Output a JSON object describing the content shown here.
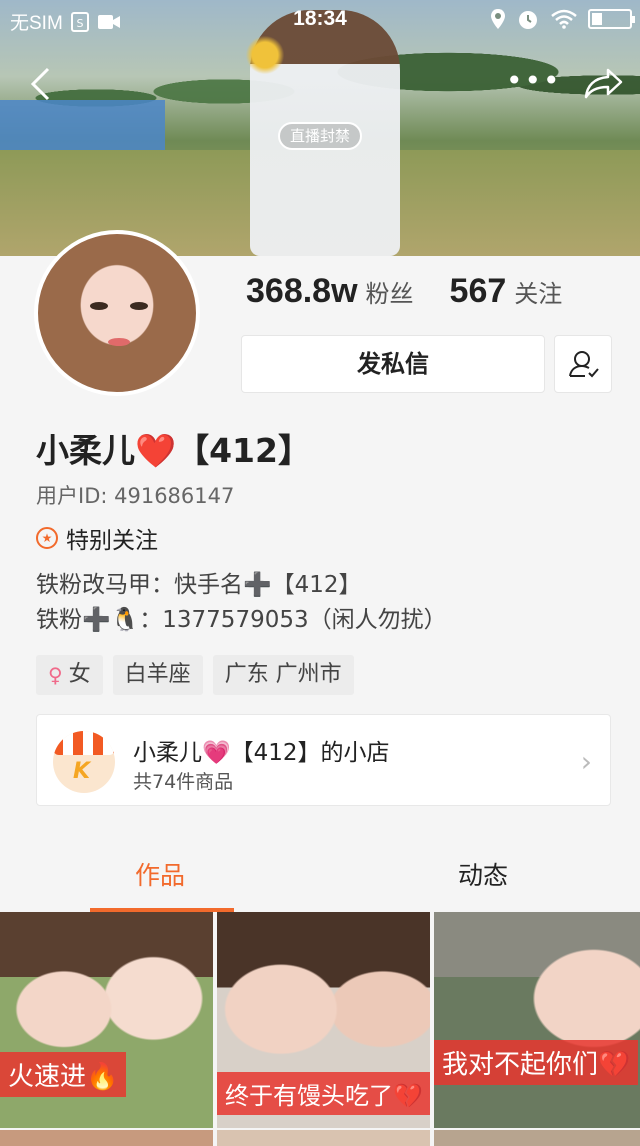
{
  "status_bar": {
    "carrier": "无SIM",
    "time": "18:34"
  },
  "cover": {
    "live_badge": "直播封禁"
  },
  "nav": {
    "back_icon": "chevron-left-icon",
    "more": "•••",
    "share_icon": "share-arrow-icon"
  },
  "profile": {
    "fans_count": "368.8w",
    "fans_label": "粉丝",
    "following_count": "567",
    "following_label": "关注",
    "message_button": "发私信",
    "name": "小柔儿❤️【412】",
    "user_id": "用户ID: 491686147",
    "special_follow": "特别关注",
    "bio_line1": "铁粉改马甲：快手名➕【412】",
    "bio_line2": "铁粉➕🐧：1377579053（闲人勿扰）"
  },
  "tags": [
    {
      "label": "女",
      "icon": "female-icon"
    },
    {
      "label": "白羊座"
    },
    {
      "label": "广东 广州市"
    }
  ],
  "shop": {
    "title": "小柔儿💗【412】的小店",
    "subtitle": "共74件商品",
    "logo_letter": "K"
  },
  "tabs": {
    "works": "作品",
    "dynamic": "动态"
  },
  "thumbnails": [
    {
      "caption": "火速进🔥"
    },
    {
      "caption": "终于有馒头吃了💔"
    },
    {
      "caption": "我对不起你们💔"
    }
  ],
  "colors": {
    "accent": "#f26a2c",
    "caption_bg": "#e8362f"
  }
}
